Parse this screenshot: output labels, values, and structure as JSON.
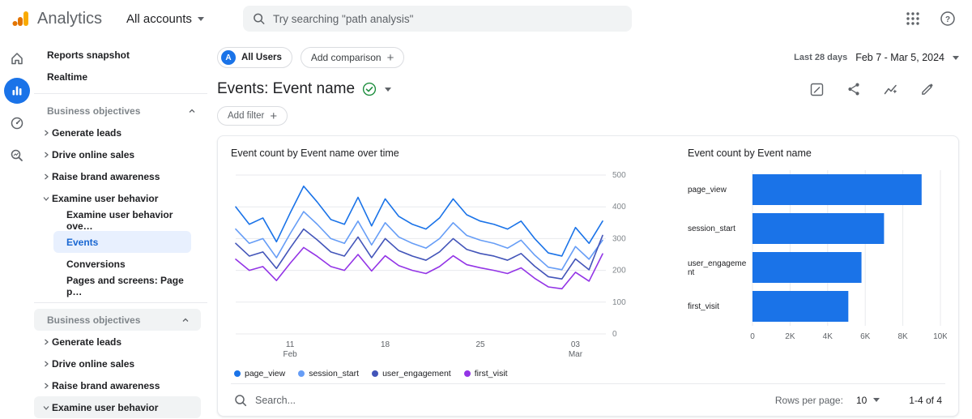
{
  "topbar": {
    "brand": "Analytics",
    "account_selector": "All accounts",
    "search_placeholder": "Try searching \"path analysis\""
  },
  "rail": {
    "items": [
      "home",
      "reports",
      "advertising",
      "explore"
    ],
    "active": "reports"
  },
  "sidebar": {
    "items": [
      {
        "label": "Reports snapshot",
        "type": "link"
      },
      {
        "label": "Realtime",
        "type": "link"
      },
      {
        "label": "Business objectives",
        "type": "section"
      },
      {
        "label": "Generate leads",
        "type": "collapsed"
      },
      {
        "label": "Drive online sales",
        "type": "collapsed"
      },
      {
        "label": "Raise brand awareness",
        "type": "collapsed"
      },
      {
        "label": "Examine user behavior",
        "type": "expanded"
      },
      {
        "label": "Examine user behavior ove…",
        "type": "child"
      },
      {
        "label": "Events",
        "type": "child",
        "selected": true
      },
      {
        "label": "Conversions",
        "type": "child"
      },
      {
        "label": "Pages and screens: Page p…",
        "type": "child"
      },
      {
        "label": "Business objectives",
        "type": "section"
      },
      {
        "label": "Generate leads",
        "type": "collapsed"
      },
      {
        "label": "Drive online sales",
        "type": "collapsed"
      },
      {
        "label": "Raise brand awareness",
        "type": "collapsed"
      },
      {
        "label": "Examine user behavior",
        "type": "collapsed"
      }
    ]
  },
  "header": {
    "segment_avatar": "A",
    "segment": "All Users",
    "add_comparison": "Add comparison",
    "date_range_label": "Last 28 days",
    "date_range_value": "Feb 7 - Mar 5, 2024",
    "title": "Events: Event name",
    "add_filter": "Add filter",
    "action_icons": [
      "customize-chart",
      "share",
      "insights",
      "edit"
    ]
  },
  "table_footer": {
    "search_placeholder": "Search...",
    "rows_per_page_label": "Rows per page:",
    "rows_per_page_value": "10",
    "range_text": "1-4 of 4"
  },
  "chart_data": [
    {
      "type": "line",
      "title": "Event count by Event name over time",
      "ylabel": "Event count",
      "ylim": [
        0,
        500
      ],
      "yticks": [
        0,
        100,
        200,
        300,
        400,
        500
      ],
      "x_count": 28,
      "x_start": "Feb 7, 2024",
      "x_end": "Mar 5, 2024",
      "xticks": [
        {
          "index": 4,
          "label": "11",
          "sub": "Feb"
        },
        {
          "index": 11,
          "label": "18"
        },
        {
          "index": 18,
          "label": "25"
        },
        {
          "index": 25,
          "label": "03",
          "sub": "Mar"
        }
      ],
      "legend_position": "bottom",
      "grid": true,
      "series": [
        {
          "name": "page_view",
          "color": "#1a73e8",
          "values": [
            400,
            345,
            365,
            290,
            380,
            465,
            415,
            360,
            345,
            430,
            340,
            425,
            370,
            345,
            330,
            365,
            425,
            375,
            355,
            345,
            330,
            355,
            300,
            255,
            245,
            335,
            285,
            355
          ]
        },
        {
          "name": "session_start",
          "color": "#669df6",
          "values": [
            330,
            285,
            300,
            240,
            315,
            385,
            345,
            300,
            285,
            355,
            280,
            350,
            305,
            285,
            270,
            300,
            350,
            310,
            295,
            285,
            270,
            295,
            248,
            210,
            202,
            275,
            235,
            295
          ]
        },
        {
          "name": "user_engagement",
          "color": "#4355b9",
          "values": [
            285,
            245,
            258,
            206,
            270,
            330,
            296,
            258,
            245,
            305,
            240,
            300,
            262,
            245,
            232,
            258,
            300,
            266,
            253,
            245,
            232,
            253,
            213,
            180,
            173,
            236,
            202,
            310
          ]
        },
        {
          "name": "first_visit",
          "color": "#9334e6",
          "values": [
            235,
            200,
            212,
            168,
            222,
            272,
            244,
            212,
            200,
            250,
            198,
            246,
            215,
            200,
            190,
            212,
            246,
            218,
            208,
            200,
            190,
            208,
            175,
            148,
            142,
            194,
            166,
            252
          ]
        }
      ]
    },
    {
      "type": "bar",
      "orientation": "horizontal",
      "title": "Event count by Event name",
      "categories": [
        "page_view",
        "session_start",
        "user_engagement",
        "first_visit"
      ],
      "values": [
        9000,
        7000,
        5800,
        5100
      ],
      "xlim": [
        0,
        10000
      ],
      "xticks": [
        {
          "v": 0,
          "label": "0"
        },
        {
          "v": 2000,
          "label": "2K"
        },
        {
          "v": 4000,
          "label": "4K"
        },
        {
          "v": 6000,
          "label": "6K"
        },
        {
          "v": 8000,
          "label": "8K"
        },
        {
          "v": 10000,
          "label": "10K"
        }
      ],
      "bar_color": "#1a73e8",
      "grid": true
    }
  ]
}
